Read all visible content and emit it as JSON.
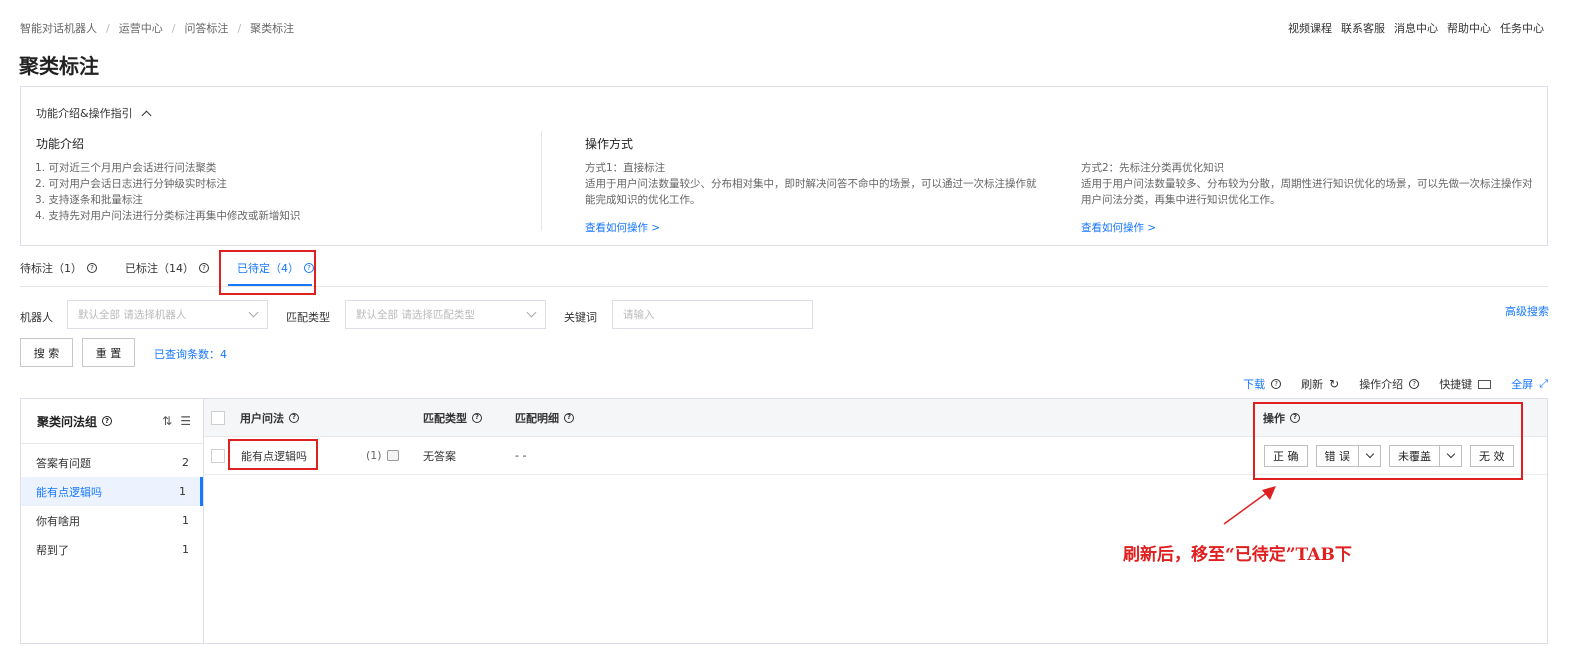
{
  "breadcrumb": [
    "智能对话机器人",
    "运营中心",
    "问答标注",
    "聚类标注"
  ],
  "top_links": [
    "视频课程",
    "联系客服",
    "消息中心",
    "帮助中心",
    "任务中心"
  ],
  "page_title": "聚类标注",
  "intro": {
    "toggle_label": "功能介绍&操作指引",
    "feature_title": "功能介绍",
    "features": [
      "1. 可对近三个月用户会话进行问法聚类",
      "2. 可对用户会话日志进行分钟级实时标注",
      "3. 支持逐条和批量标注",
      "4. 支持先对用户问法进行分类标注再集中修改或新增知识"
    ],
    "ops_title": "操作方式",
    "method1_title": "方式1：直接标注",
    "method1_desc": "适用于用户问法数量较少、分布相对集中，即时解决问答不命中的场景，可以通过一次标注操作就能完成知识的优化工作。",
    "method1_link": "查看如何操作 >",
    "method2_title": "方式2：先标注分类再优化知识",
    "method2_desc": "适用于用户问法数量较多、分布较为分散，周期性进行知识优化的场景，可以先做一次标注操作对用户问法分类，再集中进行知识优化工作。",
    "method2_link": "查看如何操作 >"
  },
  "tabs": [
    {
      "label": "待标注（1）"
    },
    {
      "label": "已标注（14）"
    },
    {
      "label": "已待定（4）"
    }
  ],
  "filters": {
    "robot_label": "机器人",
    "robot_placeholder": "默认全部 请选择机器人",
    "match_label": "匹配类型",
    "match_placeholder": "默认全部 请选择匹配类型",
    "keyword_label": "关键词",
    "keyword_placeholder": "请输入",
    "advanced": "高级搜索",
    "search_btn": "搜 索",
    "reset_btn": "重 置",
    "result_count": "已查询条数：4"
  },
  "toolbar": {
    "download": "下载",
    "refresh": "刷新",
    "guide": "操作介绍",
    "shortcut": "快捷键",
    "fullscreen": "全屏"
  },
  "groups": {
    "title": "聚类问法组",
    "items": [
      {
        "label": "答案有问题",
        "count": "2"
      },
      {
        "label": "能有点逻辑吗",
        "count": "1"
      },
      {
        "label": "你有啥用",
        "count": "1"
      },
      {
        "label": "帮到了",
        "count": "1"
      }
    ]
  },
  "table": {
    "headers": {
      "question": "用户问法",
      "match_type": "匹配类型",
      "match_detail": "匹配明细",
      "actions": "操作"
    },
    "rows": [
      {
        "question": "能有点逻辑吗",
        "freq": "(1)",
        "match_type": "无答案",
        "match_detail": "- -",
        "btn_correct": "正 确",
        "btn_wrong": "错 误",
        "btn_uncovered": "未覆盖",
        "btn_invalid": "无 效"
      }
    ]
  },
  "annotation": {
    "text": "刷新后，移至“已待定”TAB下",
    "color": "#e02020"
  }
}
